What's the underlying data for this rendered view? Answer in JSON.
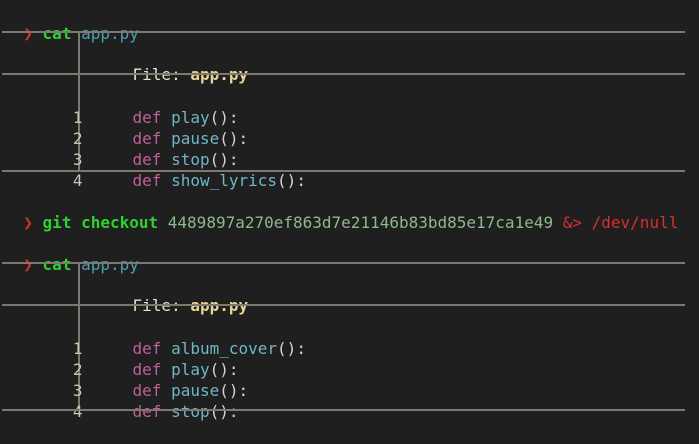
{
  "colors": {
    "background": "#1f1f1f",
    "prompt": "#d63030",
    "command": "#2fd02f",
    "argument": "#4d9fb0",
    "hash": "#8fb88f",
    "redirect": "#d63030",
    "rule": "#7a7a6e",
    "file_name": "#e8d49a",
    "keyword": "#c0609a",
    "function": "#6fb6c8"
  },
  "prompt_symbol": "❯",
  "cmd1": {
    "command": "cat",
    "arg": "app.py"
  },
  "block1": {
    "file_label": "File:",
    "file_name": "app.py",
    "lines": [
      {
        "num": "1",
        "kw": "def",
        "fn": "play",
        "rest": "():"
      },
      {
        "num": "2",
        "kw": "def",
        "fn": "pause",
        "rest": "():"
      },
      {
        "num": "3",
        "kw": "def",
        "fn": "stop",
        "rest": "():"
      },
      {
        "num": "4",
        "kw": "def",
        "fn": "show_lyrics",
        "rest": "():"
      }
    ]
  },
  "cmd2": {
    "command": "git checkout",
    "hash": "4489897a270ef863d7e21146b83bd85e17ca1e49",
    "redirect": "&>",
    "path": "/dev/null"
  },
  "cmd3": {
    "command": "cat",
    "arg": "app.py"
  },
  "block2": {
    "file_label": "File:",
    "file_name": "app.py",
    "lines": [
      {
        "num": "1",
        "kw": "def",
        "fn": "album_cover",
        "rest": "():"
      },
      {
        "num": "2",
        "kw": "def",
        "fn": "play",
        "rest": "():"
      },
      {
        "num": "3",
        "kw": "def",
        "fn": "pause",
        "rest": "():"
      },
      {
        "num": "4",
        "kw": "def",
        "fn": "stop",
        "rest": "():"
      }
    ]
  }
}
